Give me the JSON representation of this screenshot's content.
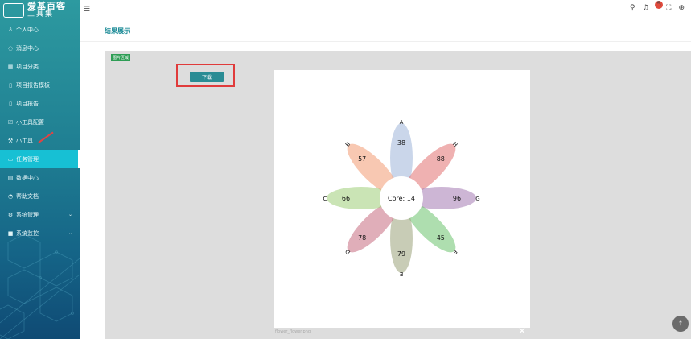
{
  "sidebar": {
    "logo": {
      "line1": "爱基百客",
      "line2": "工具集"
    },
    "items": [
      {
        "icon": "user-icon",
        "glyph": "♙",
        "label": "个人中心"
      },
      {
        "icon": "message-icon",
        "glyph": "◌",
        "label": "消息中心"
      },
      {
        "icon": "grid-icon",
        "glyph": "▦",
        "label": "项目分类"
      },
      {
        "icon": "doc-icon",
        "glyph": "▯",
        "label": "项目报告模板"
      },
      {
        "icon": "doc-icon",
        "glyph": "▯",
        "label": "项目报告"
      },
      {
        "icon": "edit-icon",
        "glyph": "☑",
        "label": "小工具配置"
      },
      {
        "icon": "wrench-icon",
        "glyph": "⚒",
        "label": "小工具"
      },
      {
        "icon": "task-icon",
        "glyph": "▭",
        "label": "任务管理",
        "active": true
      },
      {
        "icon": "data-icon",
        "glyph": "▤",
        "label": "数据中心"
      },
      {
        "icon": "help-icon",
        "glyph": "◔",
        "label": "帮助文档"
      },
      {
        "icon": "gear-icon",
        "glyph": "⚙",
        "label": "系统管理",
        "chevron": "⌄"
      },
      {
        "icon": "monitor-icon",
        "glyph": "■",
        "label": "系统监控",
        "chevron": "⌄"
      }
    ]
  },
  "topbar": {
    "collapse_glyph": "☰",
    "search_glyph": "⚲",
    "bell_glyph": "♫",
    "bell_badge": "5",
    "fullscreen_glyph": "⛶",
    "lock_glyph": "⊕"
  },
  "page": {
    "title": "结果展示"
  },
  "content": {
    "region_tag": "图片区域",
    "download_label": "下载",
    "filename": "flower_flower.png",
    "close_glyph": "✕",
    "back_top_glyph": "⤒"
  },
  "chart_data": {
    "type": "flower-venn",
    "core_label": "Core: 14",
    "petals": [
      {
        "set": "A",
        "value": 38,
        "color": "#9fb4d8",
        "angle": 0
      },
      {
        "set": "H",
        "value": 88,
        "color": "#e27171",
        "angle": 45
      },
      {
        "set": "G",
        "value": 96,
        "color": "#a47ab3",
        "angle": 90
      },
      {
        "set": "F",
        "value": 45,
        "color": "#6cc36e",
        "angle": 135
      },
      {
        "set": "E",
        "value": 79,
        "color": "#9aa27a",
        "angle": 180
      },
      {
        "set": "D",
        "value": 78,
        "color": "#c76b80",
        "angle": 225
      },
      {
        "set": "C",
        "value": 66,
        "color": "#9fce78",
        "angle": 270
      },
      {
        "set": "B",
        "value": 57,
        "color": "#f39b72",
        "angle": 315
      }
    ]
  }
}
